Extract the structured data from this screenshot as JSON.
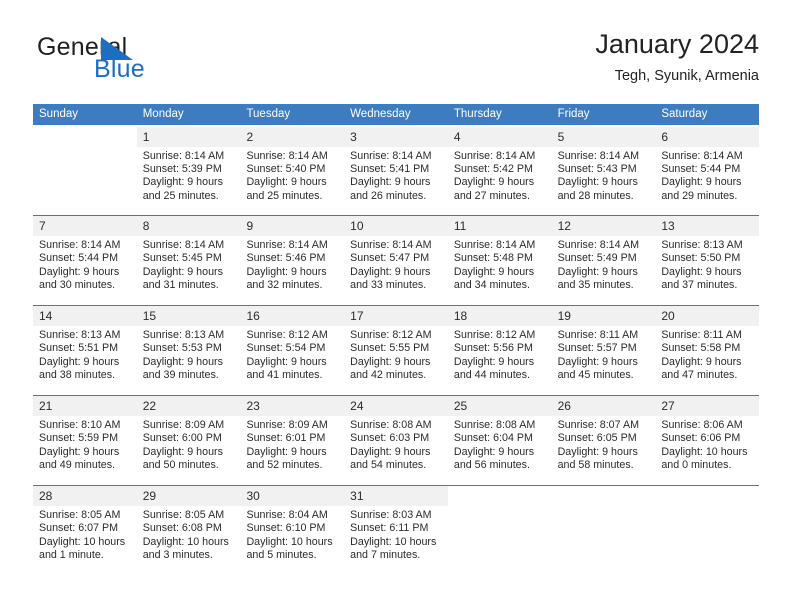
{
  "brand": {
    "name_part1": "General",
    "name_part2": "Blue",
    "triangle_color": "#1c6fc0"
  },
  "header": {
    "title": "January 2024",
    "subtitle": "Tegh, Syunik, Armenia"
  },
  "colors": {
    "header_blue": "#3d7cbf",
    "day_band_gray": "#f1f1f1",
    "text": "#2b2b2b"
  },
  "weekdays": [
    "Sunday",
    "Monday",
    "Tuesday",
    "Wednesday",
    "Thursday",
    "Friday",
    "Saturday"
  ],
  "weeks": [
    [
      {
        "blank": true,
        "day": "",
        "sunrise": "",
        "sunset": "",
        "daylight1": "",
        "daylight2": ""
      },
      {
        "blank": false,
        "day": "1",
        "sunrise": "Sunrise: 8:14 AM",
        "sunset": "Sunset: 5:39 PM",
        "daylight1": "Daylight: 9 hours",
        "daylight2": "and 25 minutes."
      },
      {
        "blank": false,
        "day": "2",
        "sunrise": "Sunrise: 8:14 AM",
        "sunset": "Sunset: 5:40 PM",
        "daylight1": "Daylight: 9 hours",
        "daylight2": "and 25 minutes."
      },
      {
        "blank": false,
        "day": "3",
        "sunrise": "Sunrise: 8:14 AM",
        "sunset": "Sunset: 5:41 PM",
        "daylight1": "Daylight: 9 hours",
        "daylight2": "and 26 minutes."
      },
      {
        "blank": false,
        "day": "4",
        "sunrise": "Sunrise: 8:14 AM",
        "sunset": "Sunset: 5:42 PM",
        "daylight1": "Daylight: 9 hours",
        "daylight2": "and 27 minutes."
      },
      {
        "blank": false,
        "day": "5",
        "sunrise": "Sunrise: 8:14 AM",
        "sunset": "Sunset: 5:43 PM",
        "daylight1": "Daylight: 9 hours",
        "daylight2": "and 28 minutes."
      },
      {
        "blank": false,
        "day": "6",
        "sunrise": "Sunrise: 8:14 AM",
        "sunset": "Sunset: 5:44 PM",
        "daylight1": "Daylight: 9 hours",
        "daylight2": "and 29 minutes."
      }
    ],
    [
      {
        "blank": false,
        "day": "7",
        "sunrise": "Sunrise: 8:14 AM",
        "sunset": "Sunset: 5:44 PM",
        "daylight1": "Daylight: 9 hours",
        "daylight2": "and 30 minutes."
      },
      {
        "blank": false,
        "day": "8",
        "sunrise": "Sunrise: 8:14 AM",
        "sunset": "Sunset: 5:45 PM",
        "daylight1": "Daylight: 9 hours",
        "daylight2": "and 31 minutes."
      },
      {
        "blank": false,
        "day": "9",
        "sunrise": "Sunrise: 8:14 AM",
        "sunset": "Sunset: 5:46 PM",
        "daylight1": "Daylight: 9 hours",
        "daylight2": "and 32 minutes."
      },
      {
        "blank": false,
        "day": "10",
        "sunrise": "Sunrise: 8:14 AM",
        "sunset": "Sunset: 5:47 PM",
        "daylight1": "Daylight: 9 hours",
        "daylight2": "and 33 minutes."
      },
      {
        "blank": false,
        "day": "11",
        "sunrise": "Sunrise: 8:14 AM",
        "sunset": "Sunset: 5:48 PM",
        "daylight1": "Daylight: 9 hours",
        "daylight2": "and 34 minutes."
      },
      {
        "blank": false,
        "day": "12",
        "sunrise": "Sunrise: 8:14 AM",
        "sunset": "Sunset: 5:49 PM",
        "daylight1": "Daylight: 9 hours",
        "daylight2": "and 35 minutes."
      },
      {
        "blank": false,
        "day": "13",
        "sunrise": "Sunrise: 8:13 AM",
        "sunset": "Sunset: 5:50 PM",
        "daylight1": "Daylight: 9 hours",
        "daylight2": "and 37 minutes."
      }
    ],
    [
      {
        "blank": false,
        "day": "14",
        "sunrise": "Sunrise: 8:13 AM",
        "sunset": "Sunset: 5:51 PM",
        "daylight1": "Daylight: 9 hours",
        "daylight2": "and 38 minutes."
      },
      {
        "blank": false,
        "day": "15",
        "sunrise": "Sunrise: 8:13 AM",
        "sunset": "Sunset: 5:53 PM",
        "daylight1": "Daylight: 9 hours",
        "daylight2": "and 39 minutes."
      },
      {
        "blank": false,
        "day": "16",
        "sunrise": "Sunrise: 8:12 AM",
        "sunset": "Sunset: 5:54 PM",
        "daylight1": "Daylight: 9 hours",
        "daylight2": "and 41 minutes."
      },
      {
        "blank": false,
        "day": "17",
        "sunrise": "Sunrise: 8:12 AM",
        "sunset": "Sunset: 5:55 PM",
        "daylight1": "Daylight: 9 hours",
        "daylight2": "and 42 minutes."
      },
      {
        "blank": false,
        "day": "18",
        "sunrise": "Sunrise: 8:12 AM",
        "sunset": "Sunset: 5:56 PM",
        "daylight1": "Daylight: 9 hours",
        "daylight2": "and 44 minutes."
      },
      {
        "blank": false,
        "day": "19",
        "sunrise": "Sunrise: 8:11 AM",
        "sunset": "Sunset: 5:57 PM",
        "daylight1": "Daylight: 9 hours",
        "daylight2": "and 45 minutes."
      },
      {
        "blank": false,
        "day": "20",
        "sunrise": "Sunrise: 8:11 AM",
        "sunset": "Sunset: 5:58 PM",
        "daylight1": "Daylight: 9 hours",
        "daylight2": "and 47 minutes."
      }
    ],
    [
      {
        "blank": false,
        "day": "21",
        "sunrise": "Sunrise: 8:10 AM",
        "sunset": "Sunset: 5:59 PM",
        "daylight1": "Daylight: 9 hours",
        "daylight2": "and 49 minutes."
      },
      {
        "blank": false,
        "day": "22",
        "sunrise": "Sunrise: 8:09 AM",
        "sunset": "Sunset: 6:00 PM",
        "daylight1": "Daylight: 9 hours",
        "daylight2": "and 50 minutes."
      },
      {
        "blank": false,
        "day": "23",
        "sunrise": "Sunrise: 8:09 AM",
        "sunset": "Sunset: 6:01 PM",
        "daylight1": "Daylight: 9 hours",
        "daylight2": "and 52 minutes."
      },
      {
        "blank": false,
        "day": "24",
        "sunrise": "Sunrise: 8:08 AM",
        "sunset": "Sunset: 6:03 PM",
        "daylight1": "Daylight: 9 hours",
        "daylight2": "and 54 minutes."
      },
      {
        "blank": false,
        "day": "25",
        "sunrise": "Sunrise: 8:08 AM",
        "sunset": "Sunset: 6:04 PM",
        "daylight1": "Daylight: 9 hours",
        "daylight2": "and 56 minutes."
      },
      {
        "blank": false,
        "day": "26",
        "sunrise": "Sunrise: 8:07 AM",
        "sunset": "Sunset: 6:05 PM",
        "daylight1": "Daylight: 9 hours",
        "daylight2": "and 58 minutes."
      },
      {
        "blank": false,
        "day": "27",
        "sunrise": "Sunrise: 8:06 AM",
        "sunset": "Sunset: 6:06 PM",
        "daylight1": "Daylight: 10 hours",
        "daylight2": "and 0 minutes."
      }
    ],
    [
      {
        "blank": false,
        "day": "28",
        "sunrise": "Sunrise: 8:05 AM",
        "sunset": "Sunset: 6:07 PM",
        "daylight1": "Daylight: 10 hours",
        "daylight2": "and 1 minute."
      },
      {
        "blank": false,
        "day": "29",
        "sunrise": "Sunrise: 8:05 AM",
        "sunset": "Sunset: 6:08 PM",
        "daylight1": "Daylight: 10 hours",
        "daylight2": "and 3 minutes."
      },
      {
        "blank": false,
        "day": "30",
        "sunrise": "Sunrise: 8:04 AM",
        "sunset": "Sunset: 6:10 PM",
        "daylight1": "Daylight: 10 hours",
        "daylight2": "and 5 minutes."
      },
      {
        "blank": false,
        "day": "31",
        "sunrise": "Sunrise: 8:03 AM",
        "sunset": "Sunset: 6:11 PM",
        "daylight1": "Daylight: 10 hours",
        "daylight2": "and 7 minutes."
      },
      {
        "blank": true,
        "day": "",
        "sunrise": "",
        "sunset": "",
        "daylight1": "",
        "daylight2": ""
      },
      {
        "blank": true,
        "day": "",
        "sunrise": "",
        "sunset": "",
        "daylight1": "",
        "daylight2": ""
      },
      {
        "blank": true,
        "day": "",
        "sunrise": "",
        "sunset": "",
        "daylight1": "",
        "daylight2": ""
      }
    ]
  ]
}
